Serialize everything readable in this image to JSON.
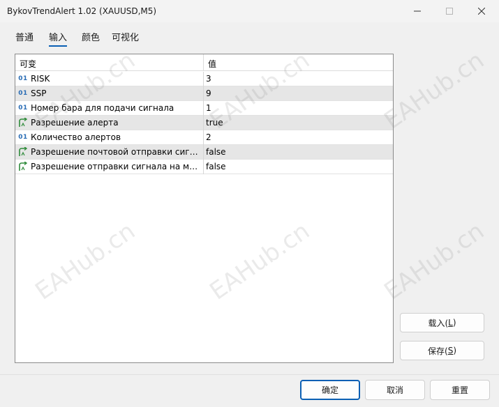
{
  "window": {
    "title": "BykovTrendAlert 1.02 (XAUUSD,M5)"
  },
  "tabs": [
    {
      "label": "普通"
    },
    {
      "label": "输入"
    },
    {
      "label": "颜色"
    },
    {
      "label": "可视化"
    }
  ],
  "grid": {
    "headers": {
      "variable": "可变",
      "value": "值"
    },
    "rows": [
      {
        "type": "int",
        "icon": "01",
        "name": "RISK",
        "value": "3"
      },
      {
        "type": "int",
        "icon": "01",
        "name": "SSP",
        "value": "9"
      },
      {
        "type": "int",
        "icon": "01",
        "name": "Номер бара для подачи сигнала",
        "value": "1"
      },
      {
        "type": "bool",
        "icon": "bool-arrow-icon",
        "name": "Разрешение алерта",
        "value": "true"
      },
      {
        "type": "int",
        "icon": "01",
        "name": "Количество алертов",
        "value": "2"
      },
      {
        "type": "bool",
        "icon": "bool-arrow-icon",
        "name": "Разрешение почтовой отправки сигн...",
        "value": "false"
      },
      {
        "type": "bool",
        "icon": "bool-arrow-icon",
        "name": "Разрешение отправки сигнала на мо...",
        "value": "false"
      }
    ]
  },
  "side_buttons": {
    "load_label": "载入(",
    "load_key": "L",
    "load_suffix": ")",
    "save_label": "保存(",
    "save_key": "S",
    "save_suffix": ")"
  },
  "footer": {
    "ok_label": "确定",
    "cancel_label": "取消",
    "reset_label": "重置"
  },
  "watermark": "EAHub.cn",
  "colors": {
    "accent": "#0a5fb4",
    "int_icon": "#2a6db5",
    "bool_icon": "#2e8b3a"
  }
}
